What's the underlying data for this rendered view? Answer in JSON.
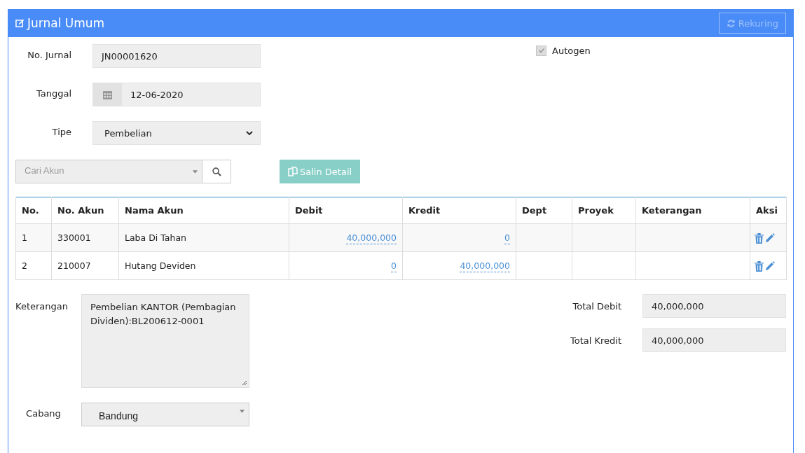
{
  "panel": {
    "title": "Jurnal Umum",
    "action_button": "Rekuring"
  },
  "fields": [
    {
      "label": "No. Jurnal",
      "kind": "text",
      "value": "JN00001620"
    },
    {
      "label": "Tanggal",
      "kind": "date",
      "value": "12-06-2020"
    },
    {
      "label": "Tipe",
      "kind": "select",
      "value": "Pembelian"
    }
  ],
  "autogen": {
    "label": "Autogen",
    "checked": true,
    "disabled": true
  },
  "account_search": {
    "placeholder": "Cari Akun"
  },
  "copy_button": "Salin Detail",
  "table": {
    "columns": [
      "No.",
      "No. Akun",
      "Nama Akun",
      "Debit",
      "Kredit",
      "Dept",
      "Proyek",
      "Keterangan",
      "Aksi"
    ],
    "rows": [
      {
        "no": "1",
        "account_no": "330001",
        "account_name": "Laba Di Tahan",
        "debit": "40,000,000",
        "kredit": "0"
      },
      {
        "no": "2",
        "account_no": "210007",
        "account_name": "Hutang Deviden",
        "debit": "0",
        "kredit": "40,000,000"
      }
    ]
  },
  "notes": {
    "label": "Keterangan",
    "value": "Pembelian KANTOR (Pembagian Dividen):BL200612-0001"
  },
  "branch": {
    "label": "Cabang",
    "value": "Bandung"
  },
  "totals": [
    {
      "label": "Total Debit",
      "value": "40,000,000"
    },
    {
      "label": "Total Kredit",
      "value": "40,000,000"
    }
  ]
}
